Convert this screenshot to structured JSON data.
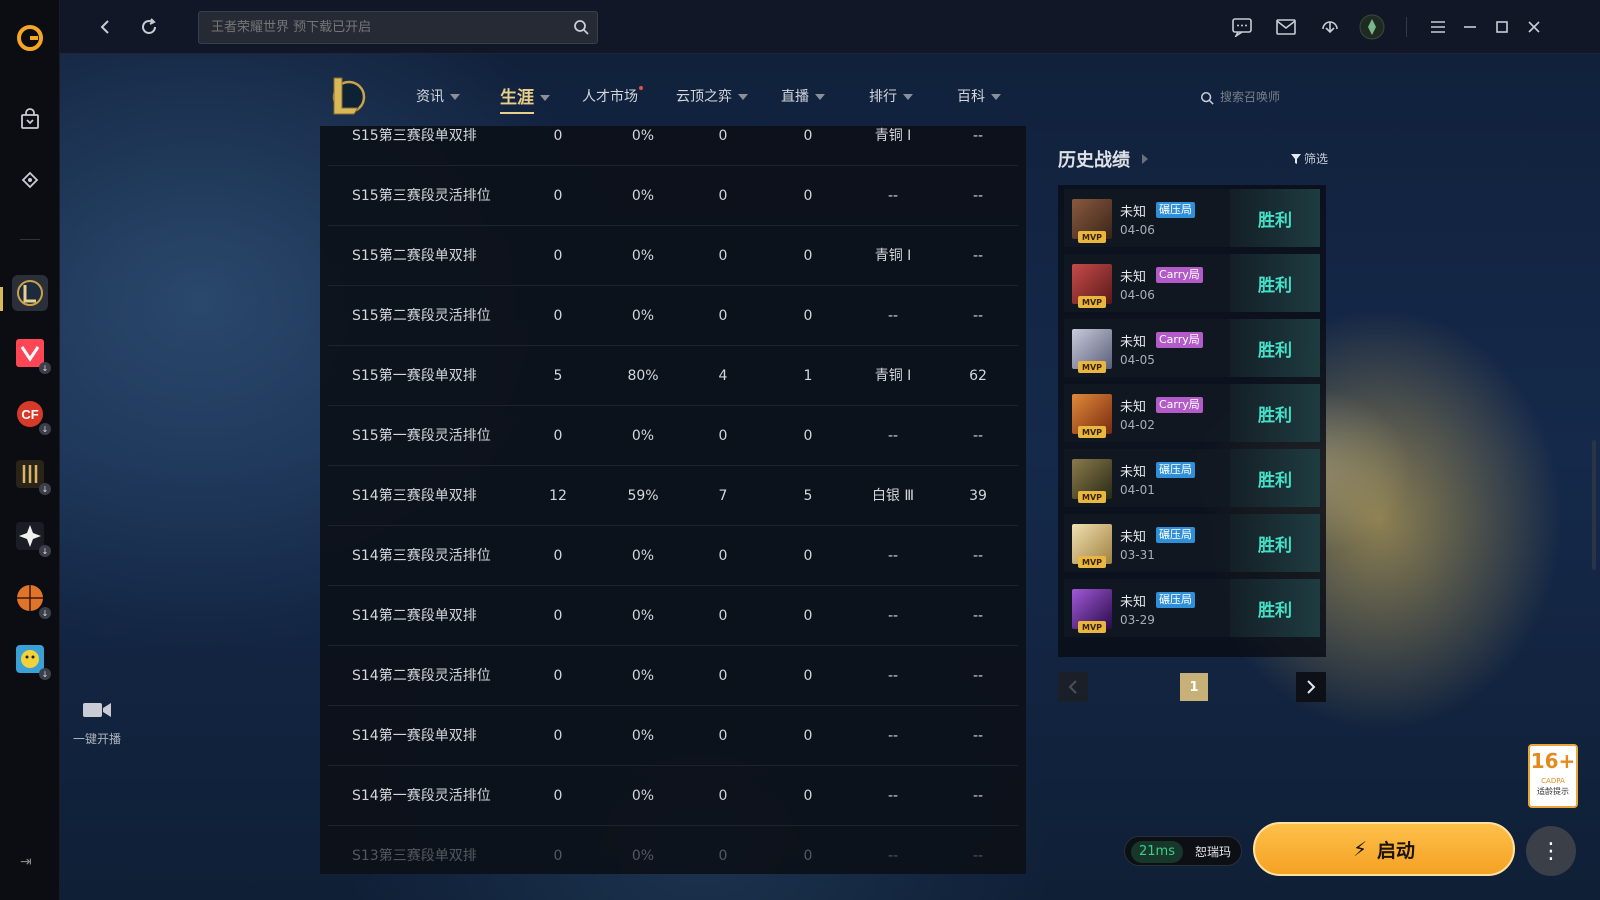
{
  "search": {
    "placeholder": "王者荣耀世界 预下载已开启"
  },
  "nav": {
    "items": [
      {
        "label": "资讯",
        "caret": true,
        "active": false
      },
      {
        "label": "生涯",
        "caret": true,
        "active": true
      },
      {
        "label": "人才市场",
        "caret": false,
        "active": false,
        "dot": true
      },
      {
        "label": "云顶之弈",
        "caret": true,
        "active": false
      },
      {
        "label": "直播",
        "caret": true,
        "active": false
      },
      {
        "label": "排行",
        "caret": true,
        "active": false
      },
      {
        "label": "百科",
        "caret": true,
        "active": false
      }
    ],
    "summoner_search_placeholder": "搜索召唤师"
  },
  "rank_table": {
    "rows": [
      {
        "season": "S15第三赛段单双排",
        "games": "0",
        "winrate": "0%",
        "wins": "0",
        "losses": "0",
        "rank": "青铜 Ⅰ",
        "points": "--"
      },
      {
        "season": "S15第三赛段灵活排位",
        "games": "0",
        "winrate": "0%",
        "wins": "0",
        "losses": "0",
        "rank": "--",
        "points": "--"
      },
      {
        "season": "S15第二赛段单双排",
        "games": "0",
        "winrate": "0%",
        "wins": "0",
        "losses": "0",
        "rank": "青铜 Ⅰ",
        "points": "--"
      },
      {
        "season": "S15第二赛段灵活排位",
        "games": "0",
        "winrate": "0%",
        "wins": "0",
        "losses": "0",
        "rank": "--",
        "points": "--"
      },
      {
        "season": "S15第一赛段单双排",
        "games": "5",
        "winrate": "80%",
        "wins": "4",
        "losses": "1",
        "rank": "青铜 Ⅰ",
        "points": "62"
      },
      {
        "season": "S15第一赛段灵活排位",
        "games": "0",
        "winrate": "0%",
        "wins": "0",
        "losses": "0",
        "rank": "--",
        "points": "--"
      },
      {
        "season": "S14第三赛段单双排",
        "games": "12",
        "winrate": "59%",
        "wins": "7",
        "losses": "5",
        "rank": "白银 Ⅲ",
        "points": "39"
      },
      {
        "season": "S14第三赛段灵活排位",
        "games": "0",
        "winrate": "0%",
        "wins": "0",
        "losses": "0",
        "rank": "--",
        "points": "--"
      },
      {
        "season": "S14第二赛段单双排",
        "games": "0",
        "winrate": "0%",
        "wins": "0",
        "losses": "0",
        "rank": "--",
        "points": "--"
      },
      {
        "season": "S14第二赛段灵活排位",
        "games": "0",
        "winrate": "0%",
        "wins": "0",
        "losses": "0",
        "rank": "--",
        "points": "--"
      },
      {
        "season": "S14第一赛段单双排",
        "games": "0",
        "winrate": "0%",
        "wins": "0",
        "losses": "0",
        "rank": "--",
        "points": "--"
      },
      {
        "season": "S14第一赛段灵活排位",
        "games": "0",
        "winrate": "0%",
        "wins": "0",
        "losses": "0",
        "rank": "--",
        "points": "--"
      },
      {
        "season": "S13第三赛段单双排",
        "games": "0",
        "winrate": "0%",
        "wins": "0",
        "losses": "0",
        "rank": "--",
        "points": "--"
      }
    ]
  },
  "history": {
    "title": "历史战绩",
    "filter_label": "筛选",
    "matches": [
      {
        "player": "未知",
        "tag": "碾压局",
        "tag_color": "blue",
        "date": "04-06",
        "result": "胜利",
        "mvp": "MVP",
        "avatar_color": "#6b4a3a"
      },
      {
        "player": "未知",
        "tag": "Carry局",
        "tag_color": "purple",
        "date": "04-06",
        "result": "胜利",
        "mvp": "MVP",
        "avatar_color": "#a33a3a"
      },
      {
        "player": "未知",
        "tag": "Carry局",
        "tag_color": "purple",
        "date": "04-05",
        "result": "胜利",
        "mvp": "MVP",
        "avatar_color": "#8f93a8"
      },
      {
        "player": "未知",
        "tag": "Carry局",
        "tag_color": "purple",
        "date": "04-02",
        "result": "胜利",
        "mvp": "MVP",
        "avatar_color": "#c0602a"
      },
      {
        "player": "未知",
        "tag": "碾压局",
        "tag_color": "blue",
        "date": "04-01",
        "result": "胜利",
        "mvp": "MVP",
        "avatar_color": "#5a5a3a"
      },
      {
        "player": "未知",
        "tag": "碾压局",
        "tag_color": "blue",
        "date": "03-31",
        "result": "胜利",
        "mvp": "MVP",
        "avatar_color": "#d8c48a"
      },
      {
        "player": "未知",
        "tag": "碾压局",
        "tag_color": "blue",
        "date": "03-29",
        "result": "胜利",
        "mvp": "MVP",
        "avatar_color": "#5a2a8a"
      }
    ],
    "page": "1"
  },
  "broadcast": {
    "label": "一键开播"
  },
  "age_rating": {
    "value": "16+",
    "org": "CADPA",
    "hint": "适龄提示"
  },
  "launch": {
    "ping": "21ms",
    "ping_label": "恕瑞玛",
    "button_label": "启动"
  },
  "colors": {
    "accent_gold": "#e8cf8a",
    "win_teal": "#45e0c8",
    "launch_orange": "#f4a224"
  }
}
